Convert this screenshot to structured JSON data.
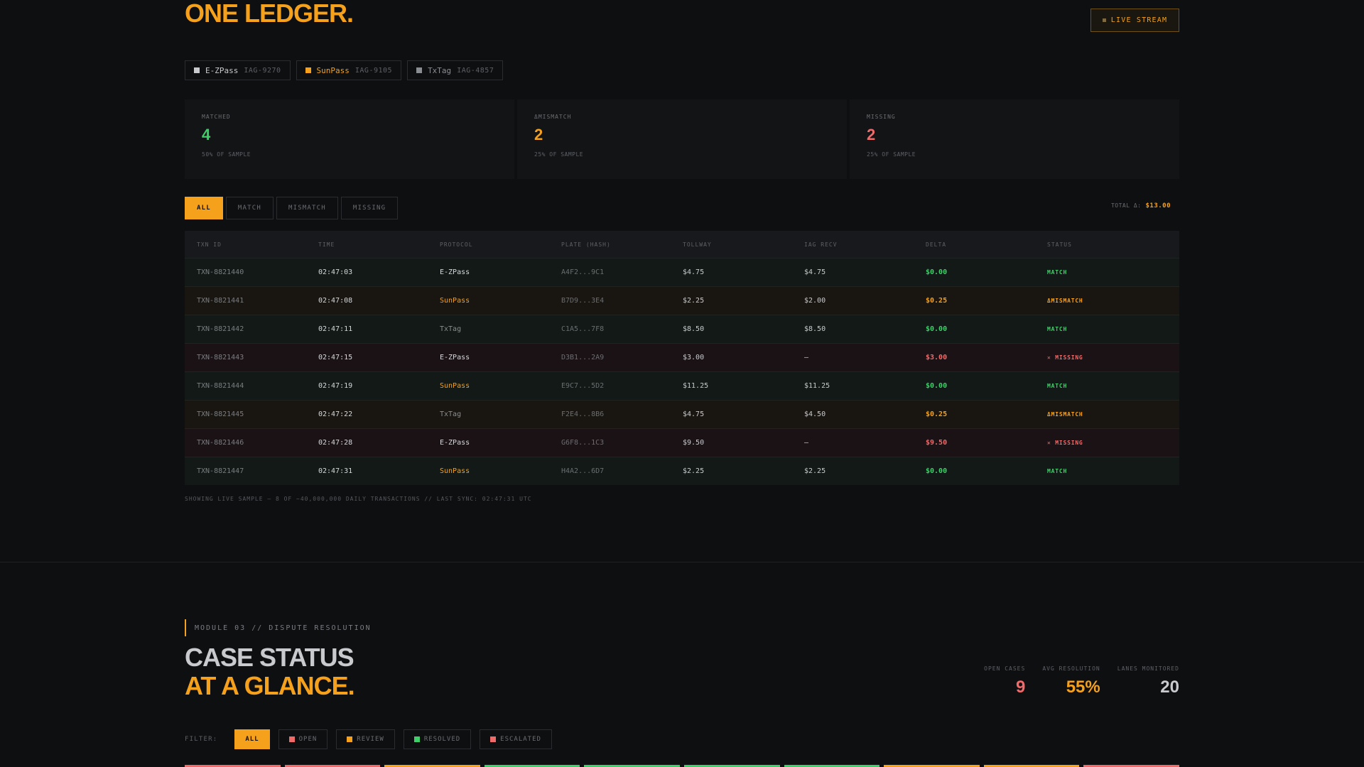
{
  "hero": {
    "title": "ONE LEDGER."
  },
  "live_button": {
    "label": "LIVE STREAM"
  },
  "protocols": [
    {
      "name": "E-ZPass",
      "id": "IAG-9270",
      "color": "#c8cacd"
    },
    {
      "name": "SunPass",
      "id": "IAG-9105",
      "color": "#f5a11c"
    },
    {
      "name": "TxTag",
      "id": "IAG-4857",
      "color": "#8a8d92"
    }
  ],
  "stats": [
    {
      "label": "MATCHED",
      "value": "4",
      "sub": "50% OF SAMPLE",
      "color": "#3ecf6a"
    },
    {
      "label": "ΔMISMATCH",
      "value": "2",
      "sub": "25% OF SAMPLE",
      "color": "#f5a11c"
    },
    {
      "label": "MISSING",
      "value": "2",
      "sub": "25% OF SAMPLE",
      "color": "#f06a6a"
    }
  ],
  "filters": [
    "ALL",
    "MATCH",
    "MISMATCH",
    "MISSING"
  ],
  "total": {
    "label": "TOTAL Δ:",
    "value": "$13.00"
  },
  "table": {
    "headers": [
      "TXN ID",
      "TIME",
      "PROTOCOL",
      "PLATE (HASH)",
      "TOLLWAY",
      "IAG RECV",
      "DELTA",
      "STATUS"
    ],
    "rows": [
      {
        "txn": "TXN-8821440",
        "time": "02:47:03",
        "protocol": "E-ZPass",
        "plate": "A4F2...9C1",
        "tollway": "$4.75",
        "iag": "$4.75",
        "delta": "$0.00",
        "status": "MATCH",
        "kind": "match"
      },
      {
        "txn": "TXN-8821441",
        "time": "02:47:08",
        "protocol": "SunPass",
        "plate": "B7D9...3E4",
        "tollway": "$2.25",
        "iag": "$2.00",
        "delta": "$0.25",
        "status": "ΔMISMATCH",
        "kind": "mismatch"
      },
      {
        "txn": "TXN-8821442",
        "time": "02:47:11",
        "protocol": "TxTag",
        "plate": "C1A5...7F8",
        "tollway": "$8.50",
        "iag": "$8.50",
        "delta": "$0.00",
        "status": "MATCH",
        "kind": "match"
      },
      {
        "txn": "TXN-8821443",
        "time": "02:47:15",
        "protocol": "E-ZPass",
        "plate": "D3B1...2A9",
        "tollway": "$3.00",
        "iag": "—",
        "delta": "$3.00",
        "status": "✕ MISSING",
        "kind": "missing"
      },
      {
        "txn": "TXN-8821444",
        "time": "02:47:19",
        "protocol": "SunPass",
        "plate": "E9C7...5D2",
        "tollway": "$11.25",
        "iag": "$11.25",
        "delta": "$0.00",
        "status": "MATCH",
        "kind": "match"
      },
      {
        "txn": "TXN-8821445",
        "time": "02:47:22",
        "protocol": "TxTag",
        "plate": "F2E4...8B6",
        "tollway": "$4.75",
        "iag": "$4.50",
        "delta": "$0.25",
        "status": "ΔMISMATCH",
        "kind": "mismatch"
      },
      {
        "txn": "TXN-8821446",
        "time": "02:47:28",
        "protocol": "E-ZPass",
        "plate": "G6F8...1C3",
        "tollway": "$9.50",
        "iag": "—",
        "delta": "$9.50",
        "status": "✕ MISSING",
        "kind": "missing"
      },
      {
        "txn": "TXN-8821447",
        "time": "02:47:31",
        "protocol": "SunPass",
        "plate": "H4A2...6D7",
        "tollway": "$2.25",
        "iag": "$2.25",
        "delta": "$0.00",
        "status": "MATCH",
        "kind": "match"
      }
    ]
  },
  "footnote": "SHOWING LIVE SAMPLE — 8 OF ~40,000,000 DAILY TRANSACTIONS // LAST SYNC: 02:47:31 UTC",
  "module": {
    "label": "MODULE 03 // DISPUTE RESOLUTION"
  },
  "case_title": {
    "line1": "CASE STATUS",
    "line2": "AT A GLANCE."
  },
  "metrics": [
    {
      "label": "OPEN CASES",
      "value": "9",
      "color": "#f06a6a"
    },
    {
      "label": "AVG RESOLUTION",
      "value": "55%",
      "color": "#f5a11c"
    },
    {
      "label": "LANES MONITORED",
      "value": "20",
      "color": "#c8cacd"
    }
  ],
  "case_filter": {
    "label": "FILTER:",
    "options": [
      {
        "label": "ALL",
        "color": ""
      },
      {
        "label": "OPEN",
        "color": "#f06a6a"
      },
      {
        "label": "REVIEW",
        "color": "#f5a11c"
      },
      {
        "label": "RESOLVED",
        "color": "#3ecf6a"
      },
      {
        "label": "ESCALATED",
        "color": "#f06a6a"
      }
    ]
  },
  "bottom_strip_colors": [
    "#f06a6a",
    "#f06a6a",
    "#f5a11c",
    "#3ecf6a",
    "#3ecf6a",
    "#3ecf6a",
    "#3ecf6a",
    "#f5a11c",
    "#f5a11c",
    "#f06a6a"
  ]
}
